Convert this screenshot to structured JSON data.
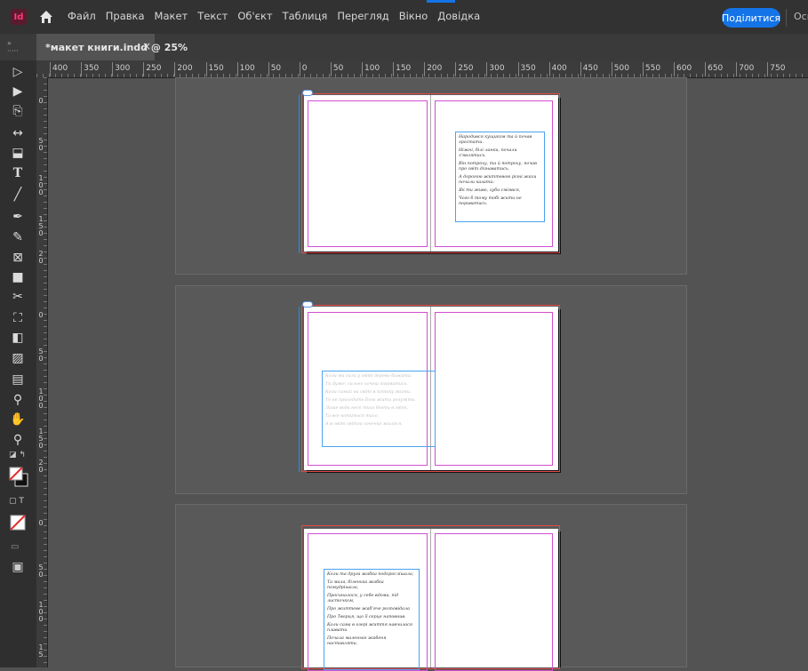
{
  "app": {
    "logo_text": "Id",
    "accent": "#1473e6"
  },
  "menu": [
    "Файл",
    "Правка",
    "Макет",
    "Текст",
    "Об'єкт",
    "Таблиця",
    "Перегляд",
    "Вікно",
    "Довідка"
  ],
  "share_label": "Поділитися",
  "workspace_label": "Осн",
  "document_tab": {
    "title": "*макет книги.indd @ 25%",
    "close": "×"
  },
  "ruler": {
    "horizontal": [
      "400",
      "350",
      "300",
      "250",
      "200",
      "150",
      "100",
      "50",
      "0",
      "50",
      "100",
      "150",
      "200",
      "250",
      "300",
      "350",
      "400",
      "450",
      "500",
      "550",
      "600",
      "650",
      "700",
      "750"
    ],
    "vertical": [
      "0",
      "5\n0",
      "1\n0\n0",
      "1\n5\n0",
      "2\n0",
      "0",
      "5\n0",
      "1\n0\n0",
      "1\n5\n0",
      "2\n0",
      "0",
      "5\n0",
      "1\n0\n0",
      "1\n5"
    ]
  },
  "tools": [
    "selection-tool",
    "direct-selection-tool",
    "page-tool",
    "gap-tool",
    "content-collector-tool",
    "type-tool",
    "line-tool",
    "pen-tool",
    "pencil-tool",
    "rectangle-frame-tool",
    "rectangle-tool",
    "scissors-tool",
    "free-transform-tool",
    "gradient-swatch-tool",
    "gradient-feather-tool",
    "note-tool",
    "eyedropper-tool",
    "hand-tool",
    "zoom-tool"
  ],
  "spread1": {
    "right_text": [
      "Народився кущиком та й почав зростати.",
      "Ніжні, білі ланки, почали з'являтись.",
      "Він потроху, та й потроху, почав про світ дізнаватись,",
      "А дорогою життєвою різні жахи почали казати:",
      "Як ти живо, хуби сміявся,",
      "Чого б тому тобі жити не пориватись."
    ]
  },
  "spread2": {
    "left_text": [
      "Коли ми сили у світі дерево бажати,",
      "Ти дуже, сильно хочеш зігріватись.",
      "Коли самий на світі в котику жити,",
      "То не приходить Бога жити розуміти.",
      "Лише вода несе тихо бегти в світі,",
      "Та все котиться тихо,",
      "А в світі світла сонечко жилося."
    ]
  },
  "spread3": {
    "left_text": [
      "Коли та друга жабка подорослішала,",
      "Та мала, біленька жабка помудрішала,",
      "Просиналося, у себе вдома, під листочком,",
      "Про життєве жаб'яче розповідала",
      "Про Творця, що її серце наповнив.",
      "Коли сама в озері життя навчилася плавати",
      "Почала маленьке жабеня наставляти."
    ]
  }
}
